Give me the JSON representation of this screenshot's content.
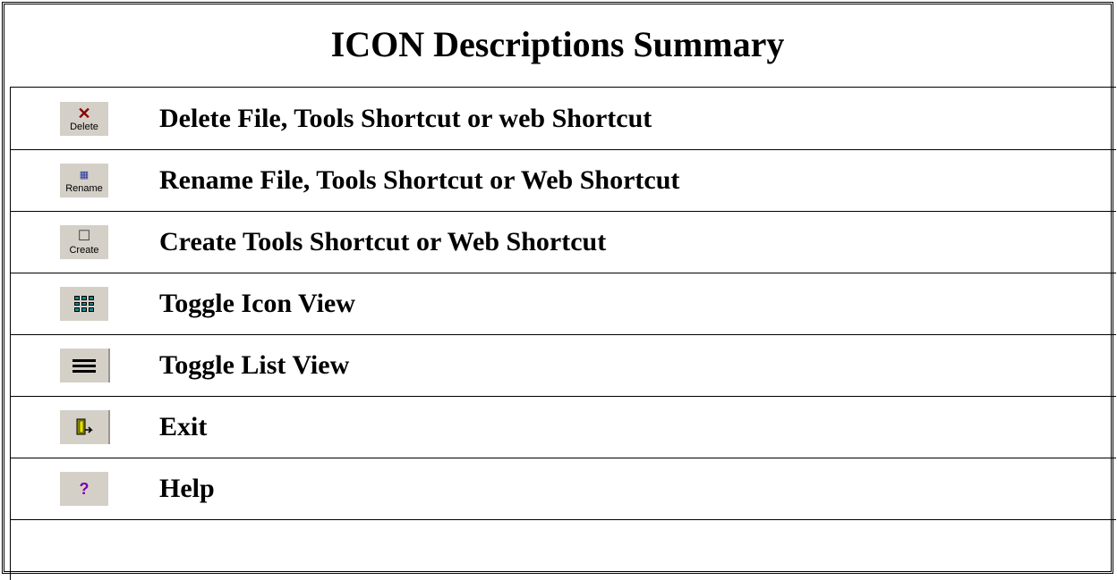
{
  "title": "ICON Descriptions Summary",
  "rows": [
    {
      "icon": "delete-icon",
      "icon_caption": "Delete",
      "label": "Delete File, Tools Shortcut or web Shortcut"
    },
    {
      "icon": "rename-icon",
      "icon_caption": "Rename",
      "label": "Rename File, Tools Shortcut or Web Shortcut"
    },
    {
      "icon": "create-icon",
      "icon_caption": "Create",
      "label": "Create Tools Shortcut or Web Shortcut"
    },
    {
      "icon": "icon-view-icon",
      "label": "Toggle Icon View"
    },
    {
      "icon": "list-view-icon",
      "label": "Toggle List View"
    },
    {
      "icon": "exit-door-icon",
      "label": "Exit"
    },
    {
      "icon": "help-question-icon",
      "icon_glyph": "?",
      "label": "Help"
    }
  ],
  "colors": {
    "icon_bg": "#d4d0c8",
    "delete_x": "#8b0000",
    "grid_teal": "#138a8a",
    "help_purple": "#7a00b0"
  }
}
